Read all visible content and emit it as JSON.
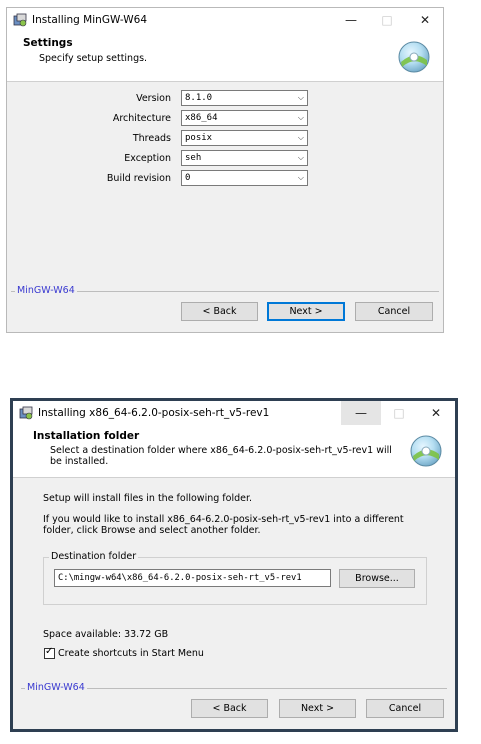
{
  "window1": {
    "title": "Installing MinGW-W64",
    "header_title": "Settings",
    "header_subtitle": "Specify setup settings.",
    "fields": [
      {
        "label": "Version",
        "value": "8.1.0"
      },
      {
        "label": "Architecture",
        "value": "x86_64"
      },
      {
        "label": "Threads",
        "value": "posix"
      },
      {
        "label": "Exception",
        "value": "seh"
      },
      {
        "label": "Build revision",
        "value": "0"
      }
    ],
    "group_label": "MinGW-W64",
    "back_label": "< Back",
    "next_label": "Next >",
    "cancel_label": "Cancel"
  },
  "window2": {
    "title": "Installing x86_64-6.2.0-posix-seh-rt_v5-rev1",
    "header_title": "Installation folder",
    "header_subtitle_line1": "Select a destination folder where x86_64-6.2.0-posix-seh-rt_v5-rev1 will",
    "header_subtitle_line2": "be installed.",
    "intro": "Setup will install files in the following folder.",
    "desc_line1": "If you would like to install x86_64-6.2.0-posix-seh-rt_v5-rev1 into a different",
    "desc_line2": "folder, click Browse and select another folder.",
    "dest_group_label": "Destination folder",
    "dest_path": "C:\\mingw-w64\\x86_64-6.2.0-posix-seh-rt_v5-rev1",
    "browse_label": "Browse...",
    "space_available": "Space available: 33.72 GB",
    "shortcut_label": "Create shortcuts in Start Menu",
    "shortcut_checked": true,
    "group_label": "MinGW-W64",
    "back_label": "< Back",
    "next_label": "Next >",
    "cancel_label": "Cancel"
  },
  "controls": {
    "minimize": "—",
    "maximize": "□",
    "close": "✕",
    "chevron": "⌵",
    "check": "✓"
  },
  "colors": {
    "accent": "#0078d7",
    "group_label": "#3a3ad0",
    "dialog_bg": "#f0f0f0"
  }
}
